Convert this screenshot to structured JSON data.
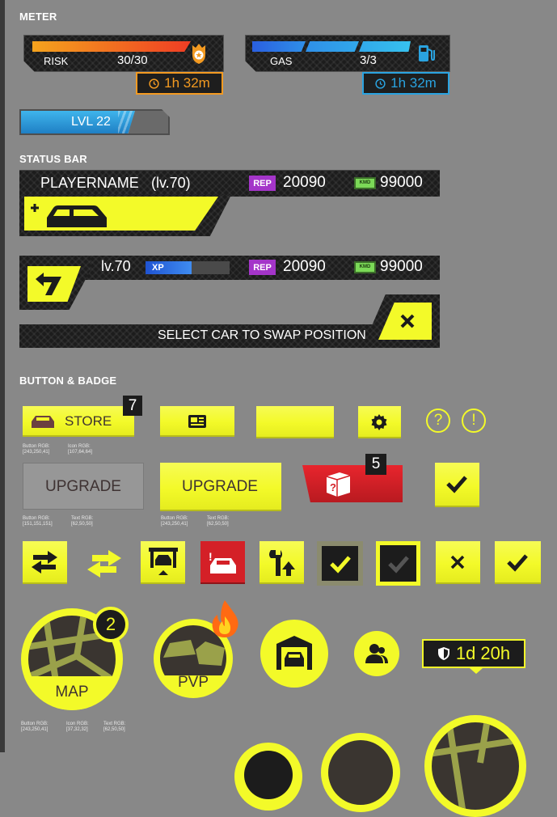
{
  "sections": {
    "meter": "METER",
    "status_bar": "STATUS BAR",
    "button_badge": "BUTTON & BADGE"
  },
  "meter": {
    "risk": {
      "label": "RISK",
      "value": "30/30",
      "timer": "1h 32m"
    },
    "gas": {
      "label": "GAS",
      "value": "3/3",
      "timer": "1h 32m"
    },
    "level": {
      "label": "LVL 22",
      "progress": 0.75
    }
  },
  "status1": {
    "player": "PLAYERNAME",
    "level": "(lv.70)",
    "rep_badge": "REP",
    "rep": "20090",
    "cash_badge": "KMD",
    "cash": "99000"
  },
  "status2": {
    "level": "lv.70",
    "xp_badge": "XP",
    "xp_progress": 0.55,
    "rep_badge": "REP",
    "rep": "20090",
    "cash_badge": "KMD",
    "cash": "99000",
    "swap_text": "SELECT CAR TO SWAP POSITION"
  },
  "buttons": {
    "store_label": "STORE",
    "store_badge": "7",
    "store_note_button": "Button RGB:",
    "store_note_button_val": "[243,250,41]",
    "store_note_icon": "Icon RGB:",
    "store_note_icon_val": "[107,64,64]",
    "upgrade_disabled": "UPGRADE",
    "upgrade_enabled": "UPGRADE",
    "up1_note_button": "Button RGB:",
    "up1_note_button_val": "[151,151,151]",
    "up1_note_text": "Text RGB:",
    "up1_note_text_val": "[62,50,50]",
    "up2_note_button": "Button RGB:",
    "up2_note_button_val": "[243,250,41]",
    "up2_note_text": "Text RGB:",
    "up2_note_text_val": "[62,50,50]",
    "box_badge": "5",
    "help_glyph": "?",
    "alert_glyph": "!"
  },
  "circles": {
    "map_label": "MAP",
    "map_badge": "2",
    "pvp_label": "PVP",
    "shield_timer": "1d 20h",
    "note_button": "Button RGB:",
    "note_button_val": "[243,250,41]",
    "note_icon": "Icon RGB:",
    "note_icon_val": "[37,32,32]",
    "note_text": "Text RGB:",
    "note_text_val": "[62,50,50]"
  },
  "colors": {
    "accent": "#f3fa29",
    "risk": "#f07a1a",
    "gas": "#2aa3e0",
    "rep": "#a435c9",
    "cash": "#7bd957",
    "xp": "#2f6fe0",
    "danger": "#d42027"
  }
}
